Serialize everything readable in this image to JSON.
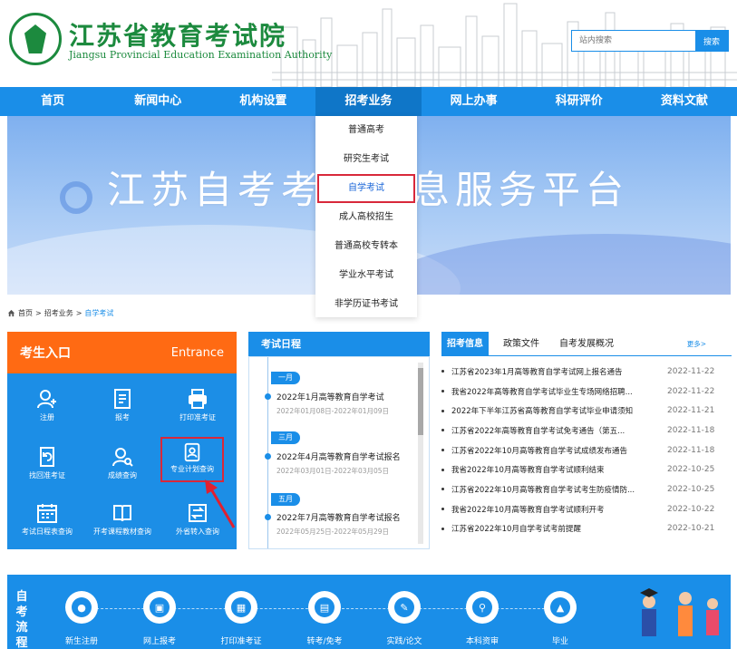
{
  "header": {
    "logo_cn": "江苏省教育考试院",
    "logo_en": "Jiangsu Provincial Education Examination Authority",
    "search_placeholder": "站内搜索",
    "search_button": "搜索"
  },
  "nav": {
    "items": [
      "首页",
      "新闻中心",
      "机构设置",
      "招考业务",
      "网上办事",
      "科研评价",
      "资料文献"
    ],
    "active_index": 3
  },
  "banner": {
    "title": "江苏自考考试信息服务平台"
  },
  "dropdown": {
    "items": [
      "普通高考",
      "研究生考试",
      "自学考试",
      "成人高校招生",
      "普通高校专转本",
      "学业水平考试",
      "非学历证书考试"
    ],
    "highlight_index": 2
  },
  "breadcrumb": {
    "home": "首页",
    "parent": "招考业务",
    "current": "自学考试",
    "separator": ">"
  },
  "entry": {
    "title": "考生入口",
    "title_en": "Entrance",
    "items": [
      {
        "label": "注册",
        "icon": "user-add-icon"
      },
      {
        "label": "报考",
        "icon": "form-icon"
      },
      {
        "label": "打印准考证",
        "icon": "printer-icon"
      },
      {
        "label": "找回准考证",
        "icon": "refresh-doc-icon"
      },
      {
        "label": "成绩查询",
        "icon": "user-search-icon"
      },
      {
        "label": "专业计划查询",
        "icon": "id-card-icon"
      },
      {
        "label": "考试日程表查询",
        "icon": "calendar-icon"
      },
      {
        "label": "开考课程教材查询",
        "icon": "book-icon"
      },
      {
        "label": "外省转入查询",
        "icon": "transfer-icon"
      }
    ],
    "highlight_index": 5
  },
  "schedule": {
    "title": "考试日程",
    "groups": [
      {
        "month": "一月",
        "name": "2022年1月高等教育自学考试",
        "date": "2022年01月08日-2022年01月09日"
      },
      {
        "month": "三月",
        "name": "2022年4月高等教育自学考试报名",
        "date": "2022年03月01日-2022年03月05日"
      },
      {
        "month": "五月",
        "name": "2022年7月高等教育自学考试报名",
        "date": "2022年05月25日-2022年05月29日"
      }
    ]
  },
  "news": {
    "tabs": [
      "招考信息",
      "政策文件",
      "自考发展概况"
    ],
    "active_tab": 0,
    "more": "更多>",
    "items": [
      {
        "title": "江苏省2023年1月高等教育自学考试网上报名通告",
        "date": "2022-11-22"
      },
      {
        "title": "我省2022年高等教育自学考试毕业生专场网络招聘...",
        "date": "2022-11-22"
      },
      {
        "title": "2022年下半年江苏省高等教育自学考试毕业申请须知",
        "date": "2022-11-21"
      },
      {
        "title": "江苏省2022年高等教育自学考试免考通告（第五...",
        "date": "2022-11-18"
      },
      {
        "title": "江苏省2022年10月高等教育自学考试成绩发布通告",
        "date": "2022-11-18"
      },
      {
        "title": "我省2022年10月高等教育自学考试顺利结束",
        "date": "2022-10-25"
      },
      {
        "title": "江苏省2022年10月高等教育自学考试考生防疫情防...",
        "date": "2022-10-25"
      },
      {
        "title": "我省2022年10月高等教育自学考试顺利开考",
        "date": "2022-10-22"
      },
      {
        "title": "江苏省2022年10月自学考试考前提醒",
        "date": "2022-10-21"
      }
    ]
  },
  "process": {
    "label": "自考流程",
    "steps": [
      "新生注册",
      "网上报考",
      "打印准考证",
      "转考/免考",
      "实践/论文",
      "本科资审",
      "毕业"
    ]
  },
  "colors": {
    "primary_blue": "#1a8ee8",
    "orange": "#ff6a13",
    "highlight_red": "#d8283a",
    "logo_green": "#1c8a3e"
  }
}
